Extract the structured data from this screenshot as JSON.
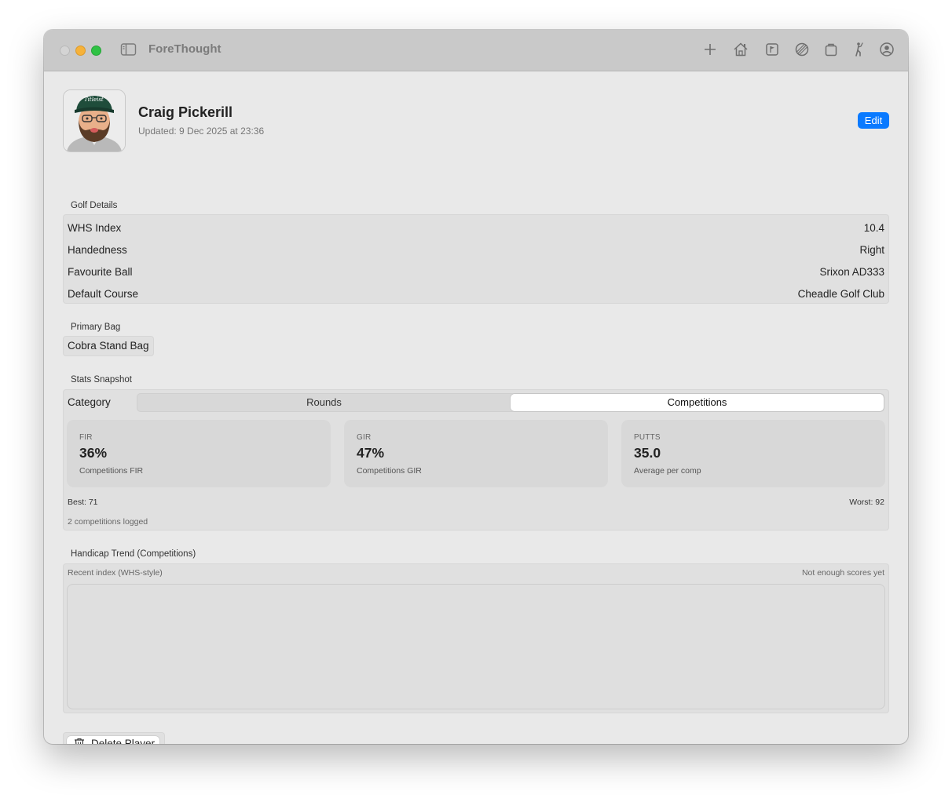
{
  "window": {
    "app_title": "ForeThought",
    "toolbar_icons": [
      "plus-icon",
      "home-icon",
      "flag-icon",
      "ball-icon",
      "bag-icon",
      "golfer-icon",
      "profile-icon"
    ]
  },
  "profile": {
    "name": "Craig Pickerill",
    "updated": "Updated: 9 Dec 2025 at 23:36",
    "edit_label": "Edit",
    "avatar_cap_text": "Titleist"
  },
  "golf_details": {
    "title": "Golf Details",
    "rows": [
      {
        "label": "WHS Index",
        "value": "10.4"
      },
      {
        "label": "Handedness",
        "value": "Right"
      },
      {
        "label": "Favourite Ball",
        "value": "Srixon AD333"
      },
      {
        "label": "Default Course",
        "value": "Cheadle Golf Club"
      }
    ]
  },
  "primary_bag": {
    "title": "Primary Bag",
    "value": "Cobra Stand Bag"
  },
  "stats": {
    "title": "Stats Snapshot",
    "category_label": "Category",
    "segments": [
      "Rounds",
      "Competitions"
    ],
    "selected_segment": "Competitions",
    "cards": [
      {
        "label": "FIR",
        "value": "36%",
        "sub": "Competitions FIR"
      },
      {
        "label": "GIR",
        "value": "47%",
        "sub": "Competitions GIR"
      },
      {
        "label": "PUTTS",
        "value": "35.0",
        "sub": "Average per comp"
      }
    ],
    "best": "Best: 71",
    "worst": "Worst: 92",
    "logged": "2 competitions logged"
  },
  "handicap_trend": {
    "title": "Handicap Trend (Competitions)",
    "subtitle": "Recent index (WHS-style)",
    "status": "Not enough scores yet"
  },
  "actions": {
    "delete_label": "Delete Player"
  },
  "colors": {
    "accent": "#0a7aff",
    "close": "#d4d4d4",
    "minimize": "#f6b23a",
    "maximize": "#2fc244"
  }
}
